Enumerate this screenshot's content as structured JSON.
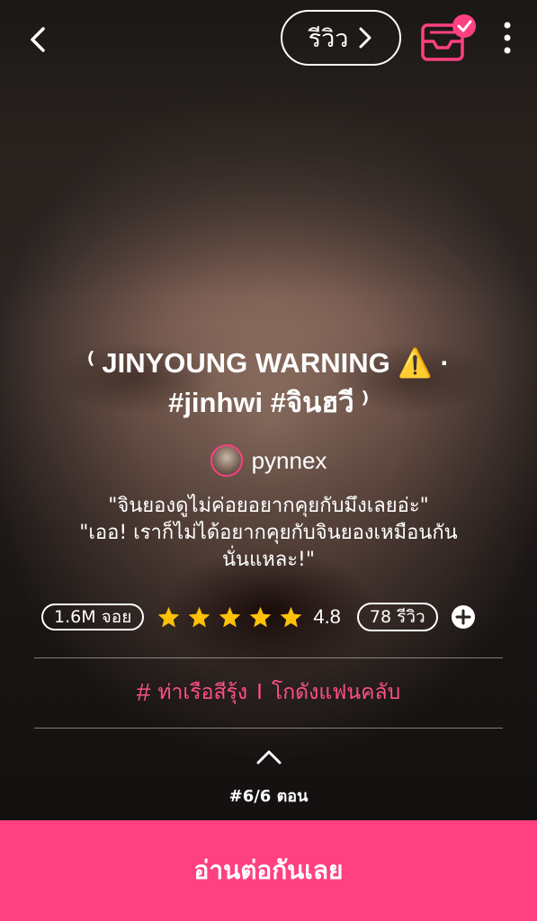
{
  "header": {
    "review_label": "รีวิว"
  },
  "story": {
    "title_line1": "⁽ JINYOUNG WARNING ⚠️ ·",
    "title_line2": "#jinhwi #จินฮวี ⁾",
    "author": "pynnex",
    "description_line1": "\"จินยองดูไม่ค่อยอยากคุยกับมึงเลยอ่ะ\"",
    "description_line2": "\"เออ! เราก็ไม่ได้อยากคุยกับจินยองเหมือนกัน",
    "description_line3": "นั่นแหละ!\""
  },
  "stats": {
    "views": "1.6M จอย",
    "rating_value": "4.8",
    "stars": 5,
    "reviews": "78 รีวิว"
  },
  "tags": {
    "tag1": "ท่าเรือสีรุ้ง",
    "separator": "I",
    "tag2": "โกดังแฟนคลับ"
  },
  "episode": {
    "label": "#6/6 ตอน"
  },
  "cta": {
    "label": "อ่านต่อกันเลย"
  },
  "colors": {
    "accent": "#ff4081",
    "star": "#ffc107",
    "text": "#ffffff"
  },
  "icons": [
    "back-arrow-icon",
    "chevron-right-icon",
    "bookshelf-check-icon",
    "more-vertical-icon",
    "star-icon",
    "plus-circle-icon",
    "hash-icon",
    "chevron-up-icon"
  ]
}
